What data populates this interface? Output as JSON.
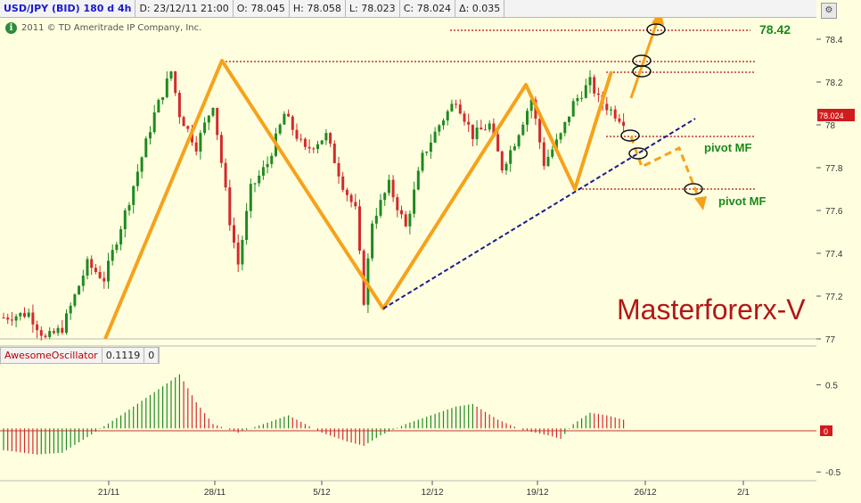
{
  "header": {
    "symbol": "USD/JPY (BID) 180 d 4h",
    "date": "D: 23/12/11 21:00",
    "open": "O: 78.045",
    "high": "H: 78.058",
    "low": "L: 78.023",
    "close": "C: 78.024",
    "change": "Δ: 0.035"
  },
  "copyright": "2011 © TD Ameritrade IP Company, Inc.",
  "indicator": {
    "name": "AwesomeOscillator",
    "value": "0.1119",
    "zero": "0"
  },
  "watermark": "Masterforerx-V",
  "annotations": {
    "target_label": "78.42",
    "pivot1": "pivot MF",
    "pivot2": "pivot MF"
  },
  "colors": {
    "bull": "#1f8a1f",
    "bear": "#d42a2a",
    "pattern": "#f7a21b",
    "trendline": "#1c1c8c",
    "level": "#c0392b",
    "price_box": "#d01c1c",
    "background": "#ffffe0"
  },
  "chart_data": [
    {
      "type": "candlestick",
      "title": "USD/JPY (BID) 180 d 4h",
      "ylim": [
        77.0,
        78.5
      ],
      "y_ticks": [
        "78.4",
        "78.2",
        "78",
        "77.8",
        "77.6",
        "77.4",
        "77.2",
        "77"
      ],
      "x_ticks": [
        "21/11",
        "28/11",
        "5/12",
        "12/12",
        "19/12",
        "26/12",
        "2/1"
      ],
      "last_price": "78.024",
      "waypoints": [
        [
          0,
          77.1
        ],
        [
          6,
          77.12
        ],
        [
          10,
          77.0
        ],
        [
          14,
          77.05
        ],
        [
          20,
          77.35
        ],
        [
          24,
          77.28
        ],
        [
          30,
          77.65
        ],
        [
          36,
          78.05
        ],
        [
          40,
          78.25
        ],
        [
          42,
          78.05
        ],
        [
          46,
          77.9
        ],
        [
          50,
          78.1
        ],
        [
          54,
          77.55
        ],
        [
          56,
          77.35
        ],
        [
          59,
          77.7
        ],
        [
          63,
          77.82
        ],
        [
          67,
          78.05
        ],
        [
          72,
          77.88
        ],
        [
          77,
          77.95
        ],
        [
          81,
          77.72
        ],
        [
          84,
          77.6
        ],
        [
          86,
          77.18
        ],
        [
          88,
          77.55
        ],
        [
          92,
          77.72
        ],
        [
          96,
          77.52
        ],
        [
          100,
          77.85
        ],
        [
          104,
          78.0
        ],
        [
          108,
          78.12
        ],
        [
          112,
          77.95
        ],
        [
          116,
          78.0
        ],
        [
          119,
          77.8
        ],
        [
          122,
          77.92
        ],
        [
          126,
          78.12
        ],
        [
          129,
          77.82
        ],
        [
          133,
          77.95
        ],
        [
          136,
          78.1
        ],
        [
          140,
          78.2
        ],
        [
          142,
          78.12
        ],
        [
          146,
          78.05
        ],
        [
          148,
          78.02
        ]
      ]
    },
    {
      "type": "histogram",
      "title": "AwesomeOscillator",
      "ylim": [
        -0.6,
        0.75
      ],
      "y_ticks": [
        "0.5",
        "0",
        "-0.5"
      ],
      "waypoints": [
        [
          0,
          -0.25
        ],
        [
          8,
          -0.3
        ],
        [
          14,
          -0.28
        ],
        [
          20,
          -0.1
        ],
        [
          28,
          0.15
        ],
        [
          34,
          0.35
        ],
        [
          40,
          0.55
        ],
        [
          42,
          0.62
        ],
        [
          46,
          0.3
        ],
        [
          50,
          0.05
        ],
        [
          56,
          -0.05
        ],
        [
          62,
          0.05
        ],
        [
          68,
          0.15
        ],
        [
          72,
          0.05
        ],
        [
          76,
          -0.05
        ],
        [
          82,
          -0.15
        ],
        [
          86,
          -0.2
        ],
        [
          90,
          -0.08
        ],
        [
          96,
          0.05
        ],
        [
          102,
          0.15
        ],
        [
          108,
          0.25
        ],
        [
          112,
          0.28
        ],
        [
          118,
          0.1
        ],
        [
          124,
          -0.02
        ],
        [
          130,
          -0.08
        ],
        [
          133,
          -0.12
        ],
        [
          136,
          0.05
        ],
        [
          140,
          0.18
        ],
        [
          144,
          0.15
        ],
        [
          148,
          0.1
        ]
      ]
    }
  ]
}
